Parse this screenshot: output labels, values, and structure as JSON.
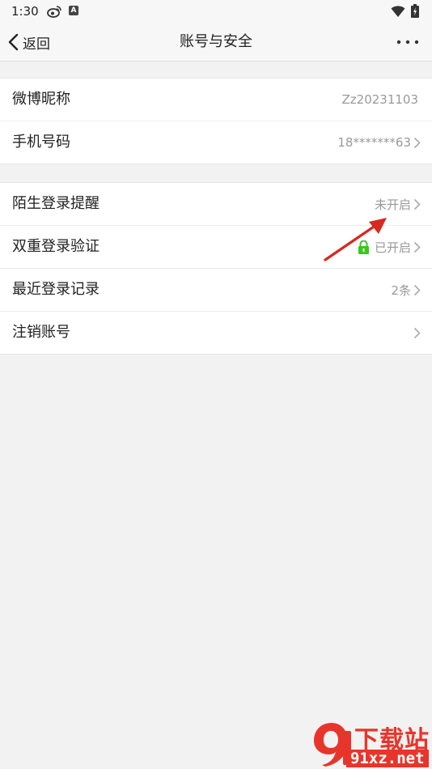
{
  "status_bar": {
    "time": "1:30",
    "icons": [
      "weibo-icon",
      "a-icon",
      "wifi-icon",
      "battery-icon"
    ],
    "a_icon_text": "A"
  },
  "nav": {
    "back_label": "返回",
    "title": "账号与安全",
    "more_icon": "more-icon"
  },
  "groups": [
    {
      "rows": [
        {
          "label": "微博昵称",
          "value": "Zz20231103",
          "chevron": false
        },
        {
          "label": "手机号码",
          "value": "18*******63",
          "chevron": true
        }
      ]
    },
    {
      "rows": [
        {
          "label": "陌生登录提醒",
          "value": "未开启",
          "chevron": true
        },
        {
          "label": "双重登录验证",
          "value": "已开启",
          "chevron": true,
          "icon": "lock-icon",
          "icon_color": "#3cc51f"
        },
        {
          "label": "最近登录记录",
          "value": "2条",
          "chevron": true
        },
        {
          "label": "注销账号",
          "value": "",
          "chevron": true
        }
      ]
    }
  ],
  "annotation": {
    "arrow_color": "#d9281e",
    "target": "双重登录验证"
  },
  "watermark": {
    "logo": "9",
    "title": "下载站",
    "domain": "91xz.net",
    "color": "#e8352c"
  },
  "colors": {
    "background": "#f2f2f2",
    "row_background": "#ffffff",
    "label": "#222222",
    "value": "#999999"
  }
}
